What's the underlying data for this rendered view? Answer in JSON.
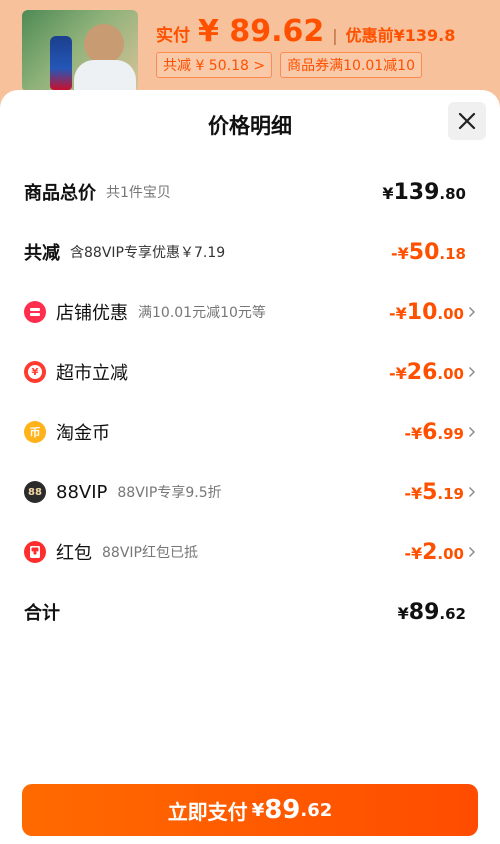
{
  "backdrop": {
    "paid_label": "实付",
    "paid_value": "¥ 89.62",
    "before_label": "优惠前¥139.8",
    "tag_reduce": "共减 ¥ 50.18 >",
    "tag_coupon": "商品券满10.01减10"
  },
  "sheet": {
    "title": "价格明细"
  },
  "rows": {
    "total": {
      "label": "商品总价",
      "sub": "共1件宝贝",
      "currency": "¥",
      "int": "139",
      "dec": ".80"
    },
    "reduce": {
      "label": "共减",
      "sub": "含88VIP专享优惠￥7.19",
      "currency": "-¥",
      "int": "50",
      "dec": ".18"
    },
    "store": {
      "label": "店铺优惠",
      "sub": "满10.01元减10元等",
      "currency": "-¥",
      "int": "10",
      "dec": ".00"
    },
    "market": {
      "label": "超市立减",
      "currency": "-¥",
      "int": "26",
      "dec": ".00"
    },
    "taojin": {
      "label": "淘金币",
      "currency": "-¥",
      "int": "6",
      "dec": ".99"
    },
    "vip": {
      "label": "88VIP",
      "sub": "88VIP专享9.5折",
      "icon_text": "88",
      "currency": "-¥",
      "int": "5",
      "dec": ".19"
    },
    "redpack": {
      "label": "红包",
      "sub": "88VIP红包已抵",
      "currency": "-¥",
      "int": "2",
      "dec": ".00"
    },
    "sum": {
      "label": "合计",
      "currency": "¥",
      "int": "89",
      "dec": ".62"
    }
  },
  "pay_button": {
    "label": "立即支付",
    "currency": "¥",
    "int": "89",
    "dec": ".62"
  },
  "colors": {
    "accent": "#ff5000",
    "button": "#ff5a00"
  }
}
